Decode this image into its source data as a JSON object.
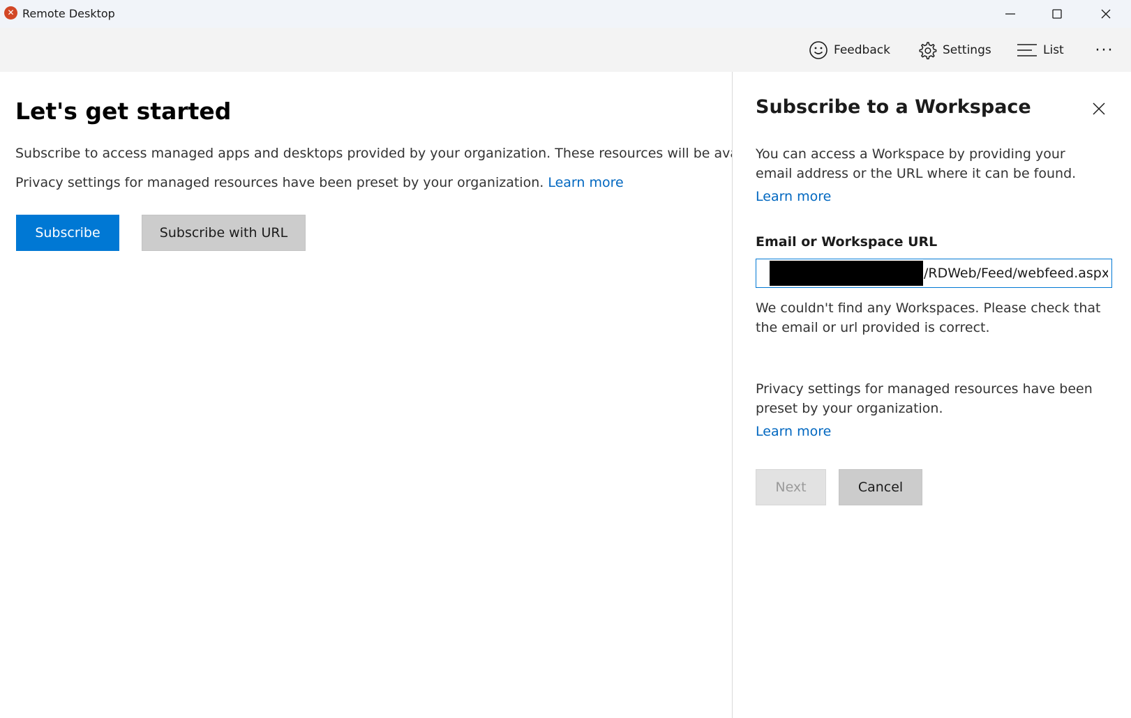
{
  "window": {
    "title": "Remote Desktop",
    "app_icon": "remote-desktop-icon",
    "minimize_glyph": "—",
    "maximize_glyph": "☐",
    "close_glyph": "✕"
  },
  "commandbar": {
    "feedback_label": "Feedback",
    "settings_label": "Settings",
    "list_label": "List",
    "more_glyph": "···"
  },
  "main": {
    "title": "Let's get started",
    "description": "Subscribe to access managed apps and desktops provided by your organization. These resources will be available",
    "privacy_text": "Privacy settings for managed resources have been preset by your organization. ",
    "privacy_link": "Learn more",
    "subscribe_label": "Subscribe",
    "subscribe_url_label": "Subscribe with URL"
  },
  "panel": {
    "title": "Subscribe to a Workspace",
    "intro": "You can access a Workspace by providing your email address or the URL where it can be found.",
    "learn_more_1": "Learn more",
    "field_label": "Email or Workspace URL",
    "field_value": "/RDWeb/Feed/webfeed.aspx",
    "error": "We couldn't find any Workspaces. Please check that the email or url provided is correct.",
    "privacy": "Privacy settings for managed resources have been preset by your organization.",
    "learn_more_2": "Learn more",
    "next_label": "Next",
    "cancel_label": "Cancel"
  },
  "colors": {
    "accent": "#0078d4",
    "link": "#0067c0",
    "titlebar_bg": "#f1f4f9",
    "commandbar_bg": "#f3f3f3"
  }
}
